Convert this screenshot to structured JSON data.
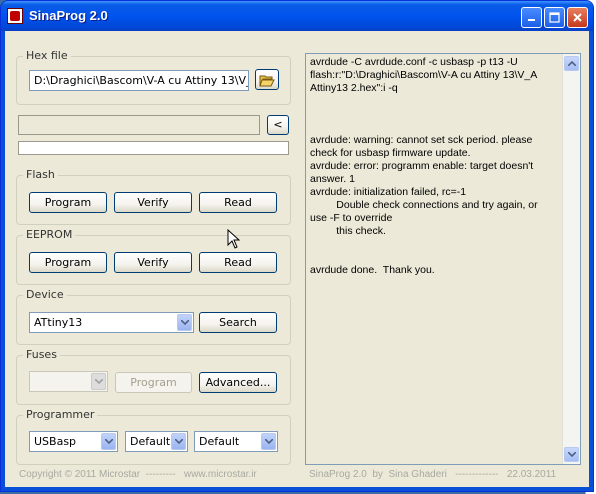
{
  "window": {
    "title": "SinaProg 2.0"
  },
  "hexfile": {
    "label": "Hex file",
    "value": "D:\\Draghici\\Bascom\\V-A cu Attiny 13\\V_A"
  },
  "arrow_button": "<",
  "flash": {
    "label": "Flash",
    "program": "Program",
    "verify": "Verify",
    "read": "Read"
  },
  "eeprom": {
    "label": "EEPROM",
    "program": "Program",
    "verify": "Verify",
    "read": "Read"
  },
  "device": {
    "label": "Device",
    "selected": "ATtiny13",
    "search": "Search"
  },
  "fuses": {
    "label": "Fuses",
    "selected": "",
    "program": "Program",
    "advanced": "Advanced..."
  },
  "programmer": {
    "label": "Programmer",
    "type": "USBasp",
    "option1": "Default",
    "option2": "Default"
  },
  "log": "avrdude -C avrdude.conf -c usbasp -p t13 -U flash:r:\"D:\\Draghici\\Bascom\\V-A cu Attiny 13\\V_A Attiny13 2.hex\":i -q\n\n\n\navrdude: warning: cannot set sck period. please check for usbasp firmware update.\navrdude: error: programm enable: target doesn't answer. 1\navrdude: initialization failed, rc=-1\n         Double check connections and try again, or use -F to override\n         this check.\n\n\navrdude done.  Thank you.",
  "footer": {
    "copyright": "Copyright © 2011 Microstar  ---------   www.microstar.ir",
    "credit": "SinaProg 2.0  by  Sina Ghaderi   -------------   22.03.2011"
  }
}
